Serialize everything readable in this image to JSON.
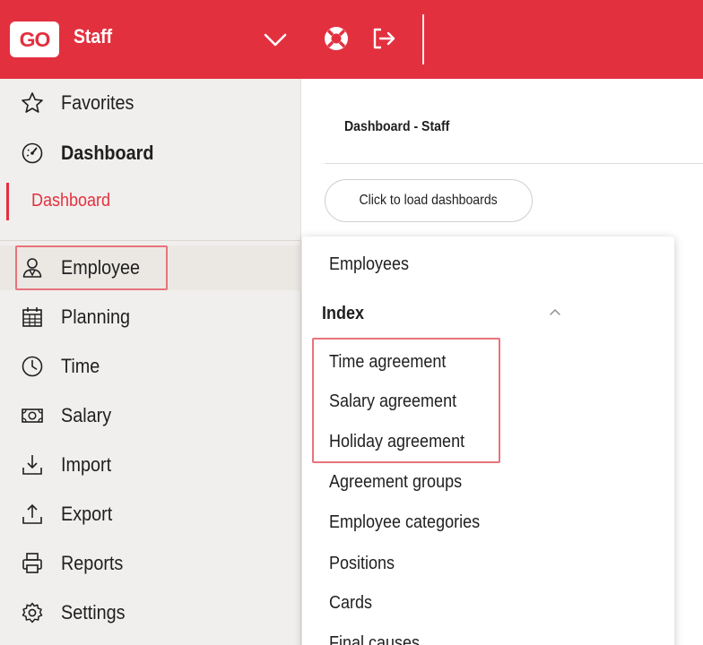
{
  "header": {
    "logo_text": "GO",
    "app_name": "Staff",
    "accent_color": "#e3303f",
    "icons": [
      "chevron-down-icon",
      "lifebuoy-icon",
      "logout-icon"
    ]
  },
  "sidebar": {
    "favorites": "Favorites",
    "dashboard_section": "Dashboard",
    "dashboard_sub": "Dashboard",
    "items": [
      {
        "label": "Employee",
        "icon": "employee-icon"
      },
      {
        "label": "Planning",
        "icon": "calendar-icon"
      },
      {
        "label": "Time",
        "icon": "clock-icon"
      },
      {
        "label": "Salary",
        "icon": "money-icon"
      },
      {
        "label": "Import",
        "icon": "import-icon"
      },
      {
        "label": "Export",
        "icon": "export-icon"
      },
      {
        "label": "Reports",
        "icon": "printer-icon"
      },
      {
        "label": "Settings",
        "icon": "gear-icon"
      }
    ]
  },
  "main": {
    "title": "Dashboard - Staff",
    "load_button": "Click to load dashboards"
  },
  "dropdown": {
    "top_item": "Employees",
    "section_header": "Index",
    "items": [
      "Time agreement",
      "Salary agreement",
      "Holiday agreement",
      "Agreement groups",
      "Employee categories",
      "Positions",
      "Cards",
      "Final causes"
    ]
  }
}
